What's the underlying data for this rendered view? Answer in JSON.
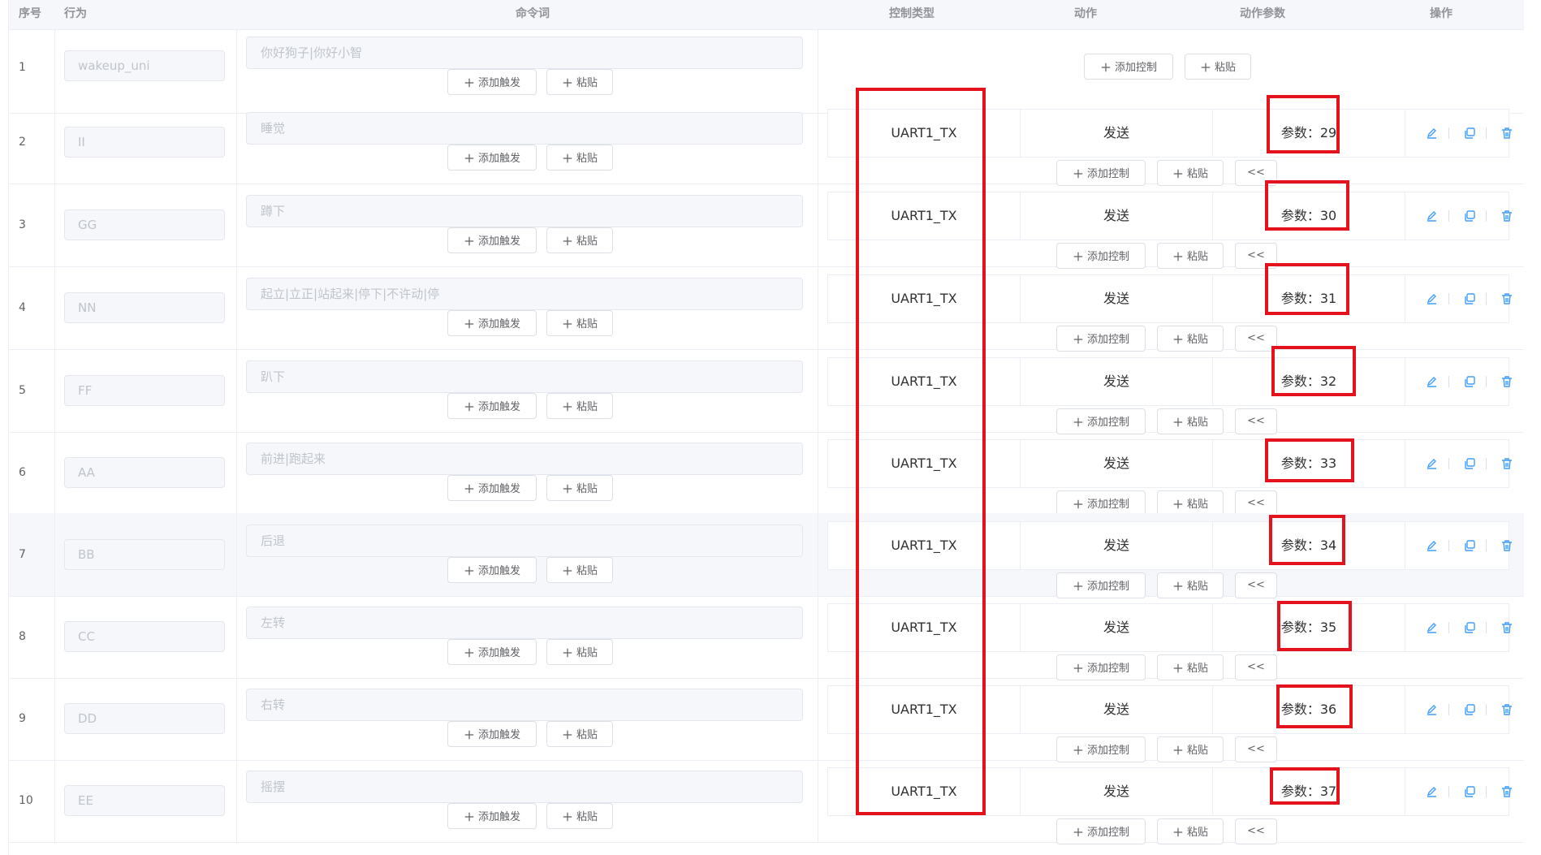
{
  "header": {
    "col_index": "序号",
    "col_behavior": "行为",
    "col_command": "命令词",
    "col_control_type": "控制类型",
    "col_action": "动作",
    "col_action_params": "动作参数",
    "col_ops": "操作"
  },
  "buttons": {
    "add_trigger": "添加触发",
    "paste": "粘贴",
    "add_control": "添加控制",
    "collapse": "<<"
  },
  "rows": [
    {
      "index": "1",
      "behavior": "wakeup_uni",
      "command": "你好狗子|你好小智",
      "control_type": "",
      "action": "",
      "param": ""
    },
    {
      "index": "2",
      "behavior": "II",
      "command": "睡觉",
      "control_type": "UART1_TX",
      "action": "发送",
      "param": "参数：29"
    },
    {
      "index": "3",
      "behavior": "GG",
      "command": "蹲下",
      "control_type": "UART1_TX",
      "action": "发送",
      "param": "参数：30"
    },
    {
      "index": "4",
      "behavior": "NN",
      "command": "起立|立正|站起来|停下|不许动|停",
      "control_type": "UART1_TX",
      "action": "发送",
      "param": "参数：31"
    },
    {
      "index": "5",
      "behavior": "FF",
      "command": "趴下",
      "control_type": "UART1_TX",
      "action": "发送",
      "param": "参数：32"
    },
    {
      "index": "6",
      "behavior": "AA",
      "command": "前进|跑起来",
      "control_type": "UART1_TX",
      "action": "发送",
      "param": "参数：33"
    },
    {
      "index": "7",
      "behavior": "BB",
      "command": "后退",
      "control_type": "UART1_TX",
      "action": "发送",
      "param": "参数：34"
    },
    {
      "index": "8",
      "behavior": "CC",
      "command": "左转",
      "control_type": "UART1_TX",
      "action": "发送",
      "param": "参数：35"
    },
    {
      "index": "9",
      "behavior": "DD",
      "command": "右转",
      "control_type": "UART1_TX",
      "action": "发送",
      "param": "参数：36"
    },
    {
      "index": "10",
      "behavior": "EE",
      "command": "摇摆",
      "control_type": "UART1_TX",
      "action": "发送",
      "param": "参数：37"
    }
  ],
  "icons": [
    "plus-icon",
    "edit-icon",
    "copy-icon",
    "delete-icon"
  ],
  "colors": {
    "accent": "#409eff",
    "highlight_box": "#e3121d",
    "disabled_text": "#c0c4cc"
  }
}
